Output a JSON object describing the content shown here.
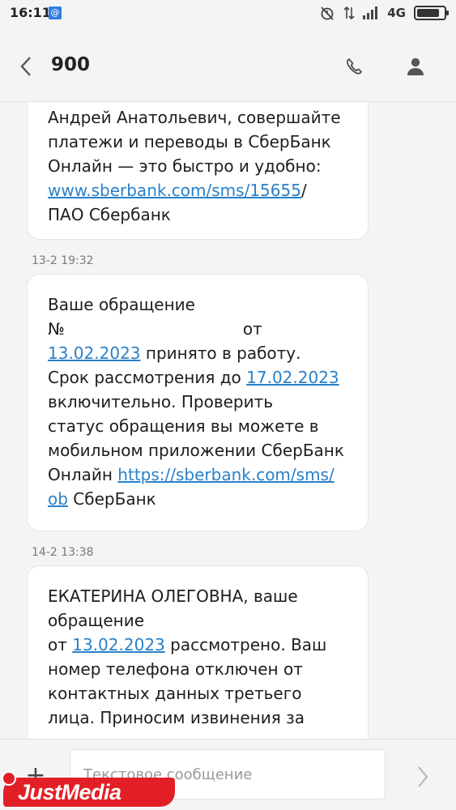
{
  "status_bar": {
    "time": "16:11",
    "notification": "@",
    "network": "4G",
    "battery_level": 0.85
  },
  "header": {
    "contact": "900"
  },
  "messages": [
    {
      "lines": [
        [
          {
            "t": "Андрей Анатольевич, совершайте"
          }
        ],
        [
          {
            "t": "платежи и переводы в СберБанк"
          }
        ],
        [
          {
            "t": "Онлайн — это быстро и удобно:"
          }
        ],
        [
          {
            "t": "www.sberbank.com/sms/15655",
            "link": true
          },
          {
            "t": "/"
          }
        ],
        [
          {
            "t": "ПАО Сбербанк"
          }
        ]
      ]
    },
    {
      "timestamp": "13-2 19:32",
      "lines": [
        [
          {
            "t": "Ваше обращение"
          }
        ],
        [
          {
            "t": "№"
          },
          {
            "t": "от",
            "gap": true
          }
        ],
        [
          {
            "t": "13.02.2023",
            "link": true
          },
          {
            "t": " принято в работу."
          }
        ],
        [
          {
            "t": "Срок рассмотрения до "
          },
          {
            "t": "17.02.2023",
            "link": true
          }
        ],
        [
          {
            "t": "включительно. Проверить"
          }
        ],
        [
          {
            "t": "статус обращения вы можете в"
          }
        ],
        [
          {
            "t": "мобильном приложении СберБанк"
          }
        ],
        [
          {
            "t": "Онлайн "
          },
          {
            "t": "https://sberbank.com/sms/",
            "link": true
          }
        ],
        [
          {
            "t": "ob",
            "link": true
          },
          {
            "t": " СберБанк"
          }
        ]
      ]
    },
    {
      "timestamp": "14-2 13:38",
      "lines": [
        [
          {
            "t": "ЕКАТЕРИНА ОЛЕГОВНА, ваше"
          }
        ],
        [
          {
            "t": "обращение"
          }
        ],
        [
          {
            "t": "от "
          },
          {
            "t": "13.02.2023",
            "link": true
          },
          {
            "t": " рассмотрено. Ваш"
          }
        ],
        [
          {
            "t": "номер телефона отключен от"
          }
        ],
        [
          {
            "t": "контактных данных третьего"
          }
        ],
        [
          {
            "t": "лица. Приносим извинения за"
          }
        ]
      ]
    }
  ],
  "composer": {
    "placeholder": "Текстовое сообщение",
    "attach_symbol": "+"
  },
  "watermark": {
    "text": "JustMedia"
  },
  "icons": {
    "back": "chevron-left-icon",
    "call": "phone-icon",
    "profile": "person-icon",
    "send": "chevron-right-icon"
  },
  "colors": {
    "link": "#2a80c9",
    "background": "#f4f4f4",
    "bubble": "#ffffff",
    "watermark": "#e21f26"
  }
}
